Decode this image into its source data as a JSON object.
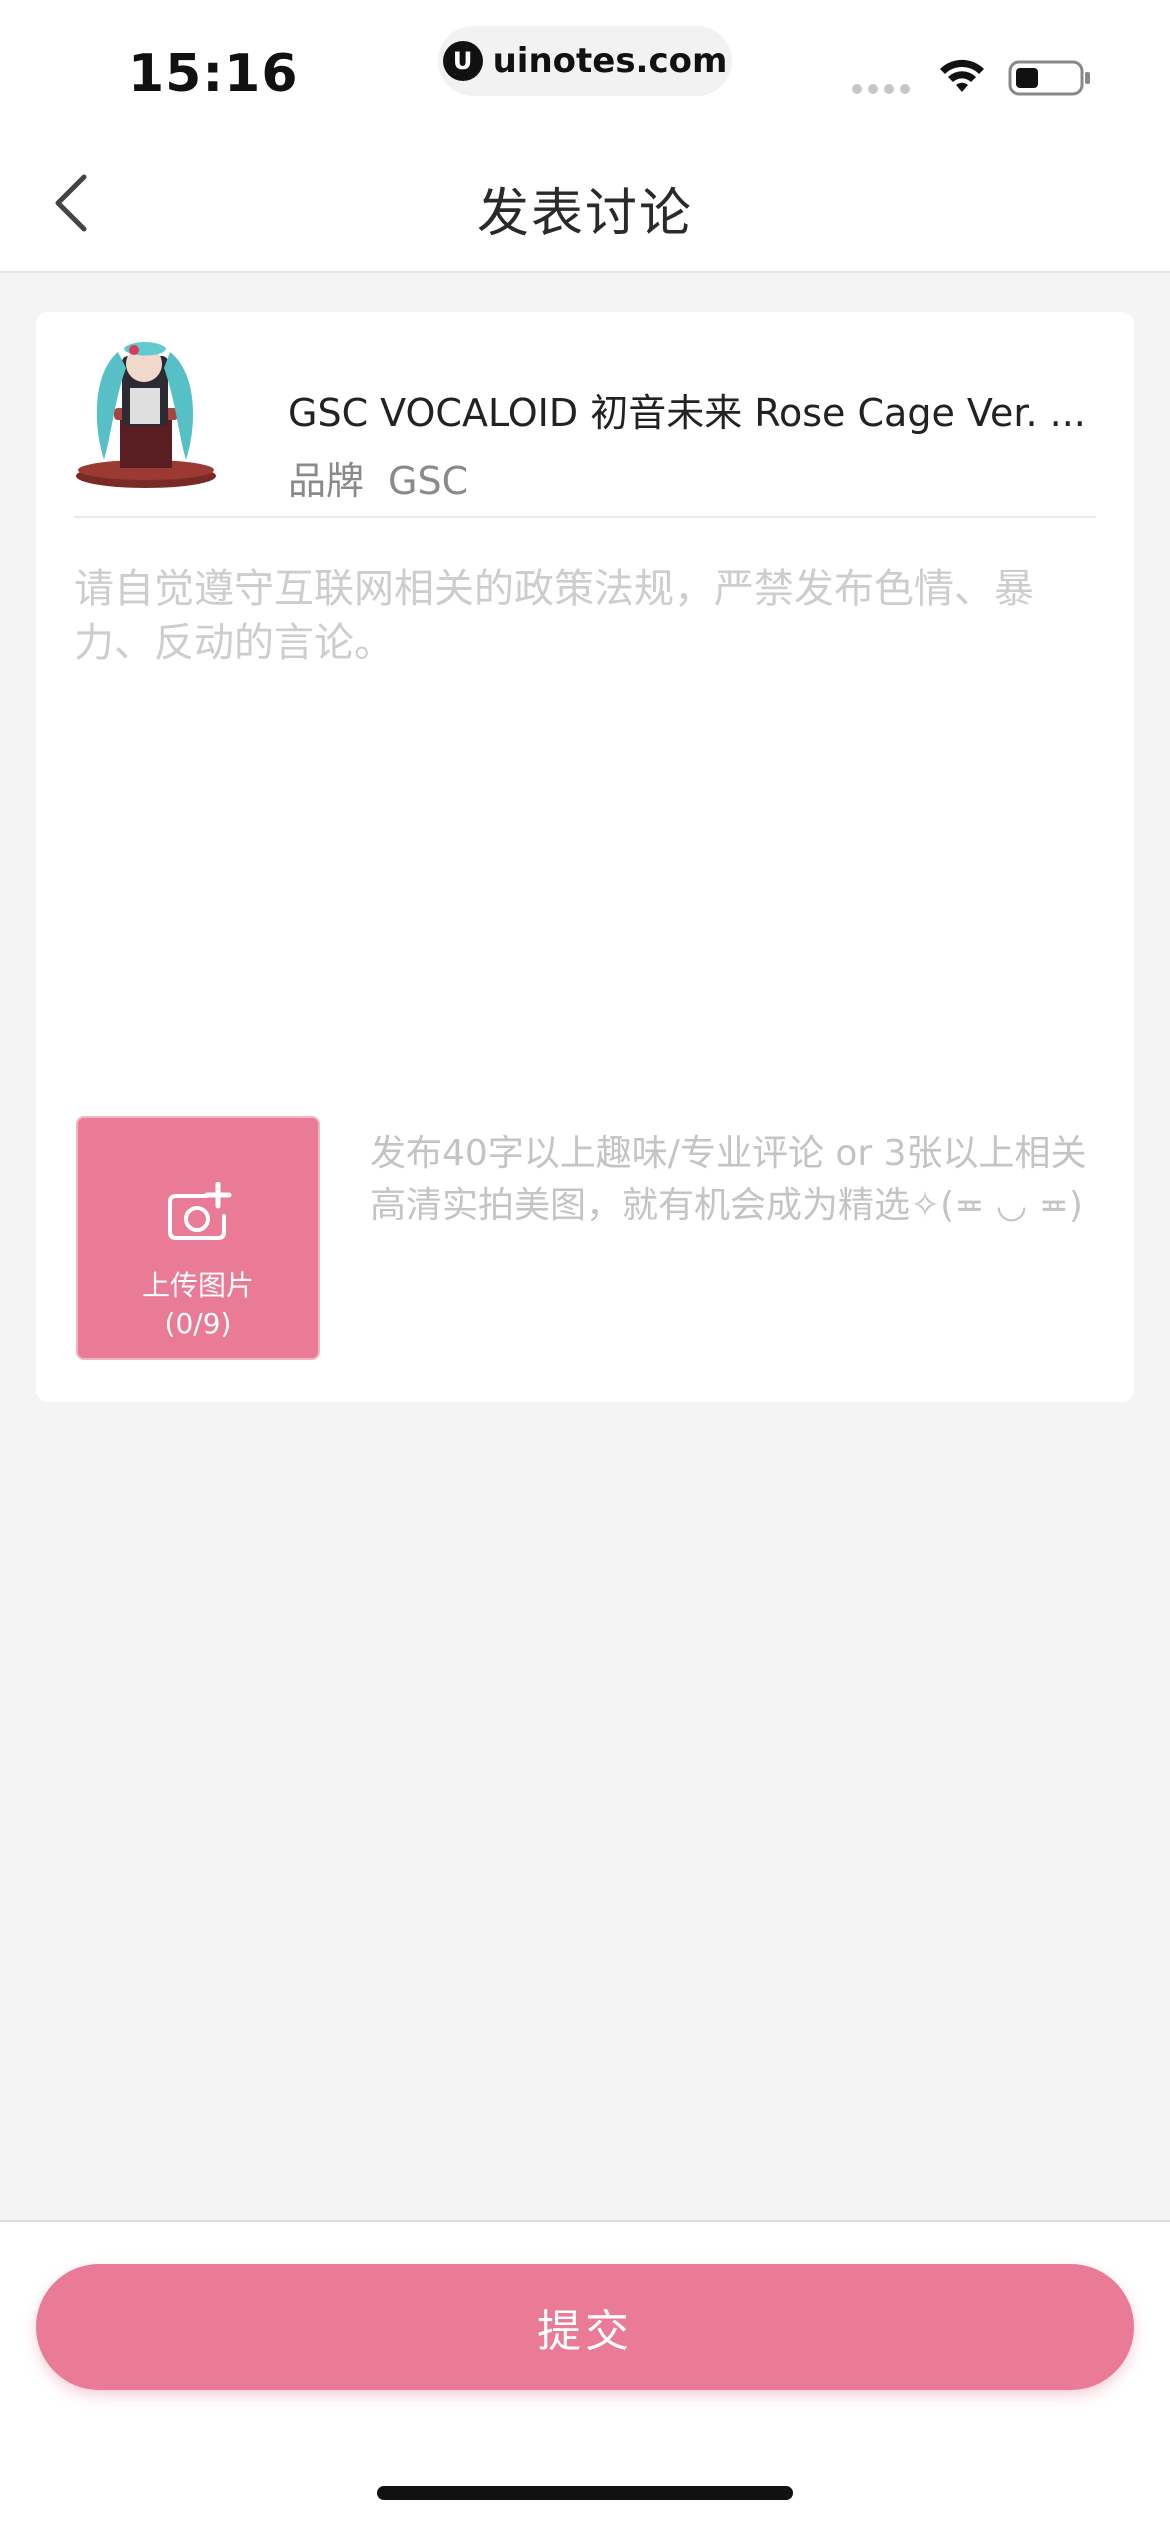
{
  "status_bar": {
    "time": "15:16",
    "url": "uinotes.com",
    "url_logo": "U",
    "icons": [
      "signal-dots-icon",
      "wifi-icon",
      "battery-icon"
    ]
  },
  "nav": {
    "back_icon": "chevron-left-icon",
    "title": "发表讨论"
  },
  "product": {
    "title": "GSC VOCALOID 初音未来 Rose Cage Ver. ...",
    "brand_label": "品牌",
    "brand_value": "GSC"
  },
  "post": {
    "placeholder": "请自觉遵守互联网相关的政策法规，严禁发布色情、暴力、反动的言论。",
    "value": ""
  },
  "upload": {
    "icon": "camera-add-icon",
    "label": "上传图片",
    "count": "(0/9)",
    "hint": "发布40字以上趣味/专业评论 or 3张以上相关高清实拍美图，就有机会成为精选✧(≖ ◡ ≖)"
  },
  "footer": {
    "submit_label": "提交"
  },
  "colors": {
    "accent": "#e97b97",
    "background": "#f4f4f4",
    "placeholder": "#cdcdcd"
  }
}
